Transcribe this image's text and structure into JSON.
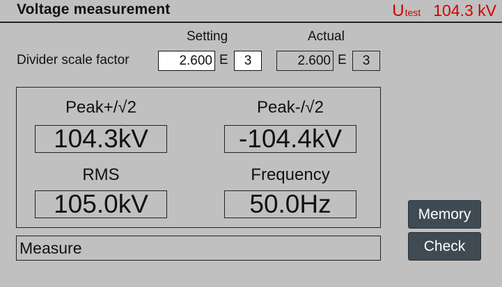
{
  "header": {
    "title": "Voltage measurement",
    "utest_symbol": "U",
    "utest_subscript": "test",
    "utest_value": "104.3 kV"
  },
  "divider": {
    "label": "Divider scale factor",
    "setting_header": "Setting",
    "actual_header": "Actual",
    "setting_mantissa": "2.600",
    "setting_exponent": "3",
    "actual_mantissa": "2.600",
    "actual_exponent": "3",
    "e_symbol": "E"
  },
  "measurements": {
    "peak_plus_label": "Peak+/√2",
    "peak_plus_value": "104.3kV",
    "peak_minus_label": "Peak-/√2",
    "peak_minus_value": "-104.4kV",
    "rms_label": "RMS",
    "rms_value": "105.0kV",
    "frequency_label": "Frequency",
    "frequency_value": "50.0Hz"
  },
  "status": {
    "text": "Measure"
  },
  "buttons": {
    "memory": "Memory",
    "check": "Check"
  },
  "colors": {
    "background": "#c0c0c0",
    "accent_red": "#d10000",
    "button_bg": "#404a52"
  }
}
